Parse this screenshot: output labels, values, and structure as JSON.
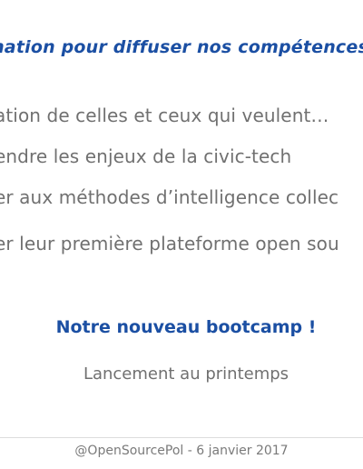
{
  "slide": {
    "heading": "mation pour diffuser nos compétences",
    "bullets": [
      "ation de celles et ceux qui veulent…",
      "endre les enjeux de la civic-tech",
      "er aux méthodes d’intelligence collec",
      "er leur première plateforme open sou"
    ],
    "highlight": "Notre nouveau bootcamp !",
    "subtitle": "Lancement au printemps",
    "footer": "@OpenSourcePol - 6 janvier 2017"
  },
  "colors": {
    "accent_blue": "#1b4fa3",
    "body_gray": "#707070",
    "background": "#ffffff"
  }
}
